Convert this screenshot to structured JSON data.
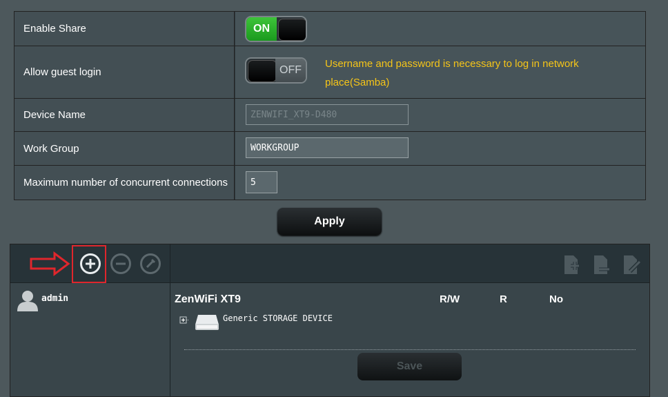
{
  "settings": {
    "enable_share": {
      "label": "Enable Share",
      "state": "ON"
    },
    "guest_login": {
      "label": "Allow guest login",
      "state": "OFF",
      "hint": "Username and password is necessary to log in network place(Samba)"
    },
    "device_name": {
      "label": "Device Name",
      "value": "ZENWIFI_XT9-D480"
    },
    "work_group": {
      "label": "Work Group",
      "value": "WORKGROUP"
    },
    "max_connections": {
      "label": "Maximum number of concurrent connections",
      "value": "5"
    }
  },
  "apply_label": "Apply",
  "toolbar": {
    "icons": [
      "add-circle-icon",
      "remove-circle-icon",
      "edit-circle-icon",
      "add-folder-icon",
      "delete-folder-icon",
      "edit-folder-icon"
    ]
  },
  "accounts": [
    {
      "name": "admin"
    }
  ],
  "permissions": {
    "title": "ZenWiFi XT9",
    "headers": {
      "rw": "R/W",
      "r": "R",
      "no": "No"
    },
    "devices": [
      {
        "name": "Generic STORAGE DEVICE"
      }
    ]
  },
  "save_label": "Save",
  "colors": {
    "background": "#4d585c",
    "toggle_on": "#2db22c",
    "hint": "#f6c518",
    "highlight": "#e0262c"
  }
}
